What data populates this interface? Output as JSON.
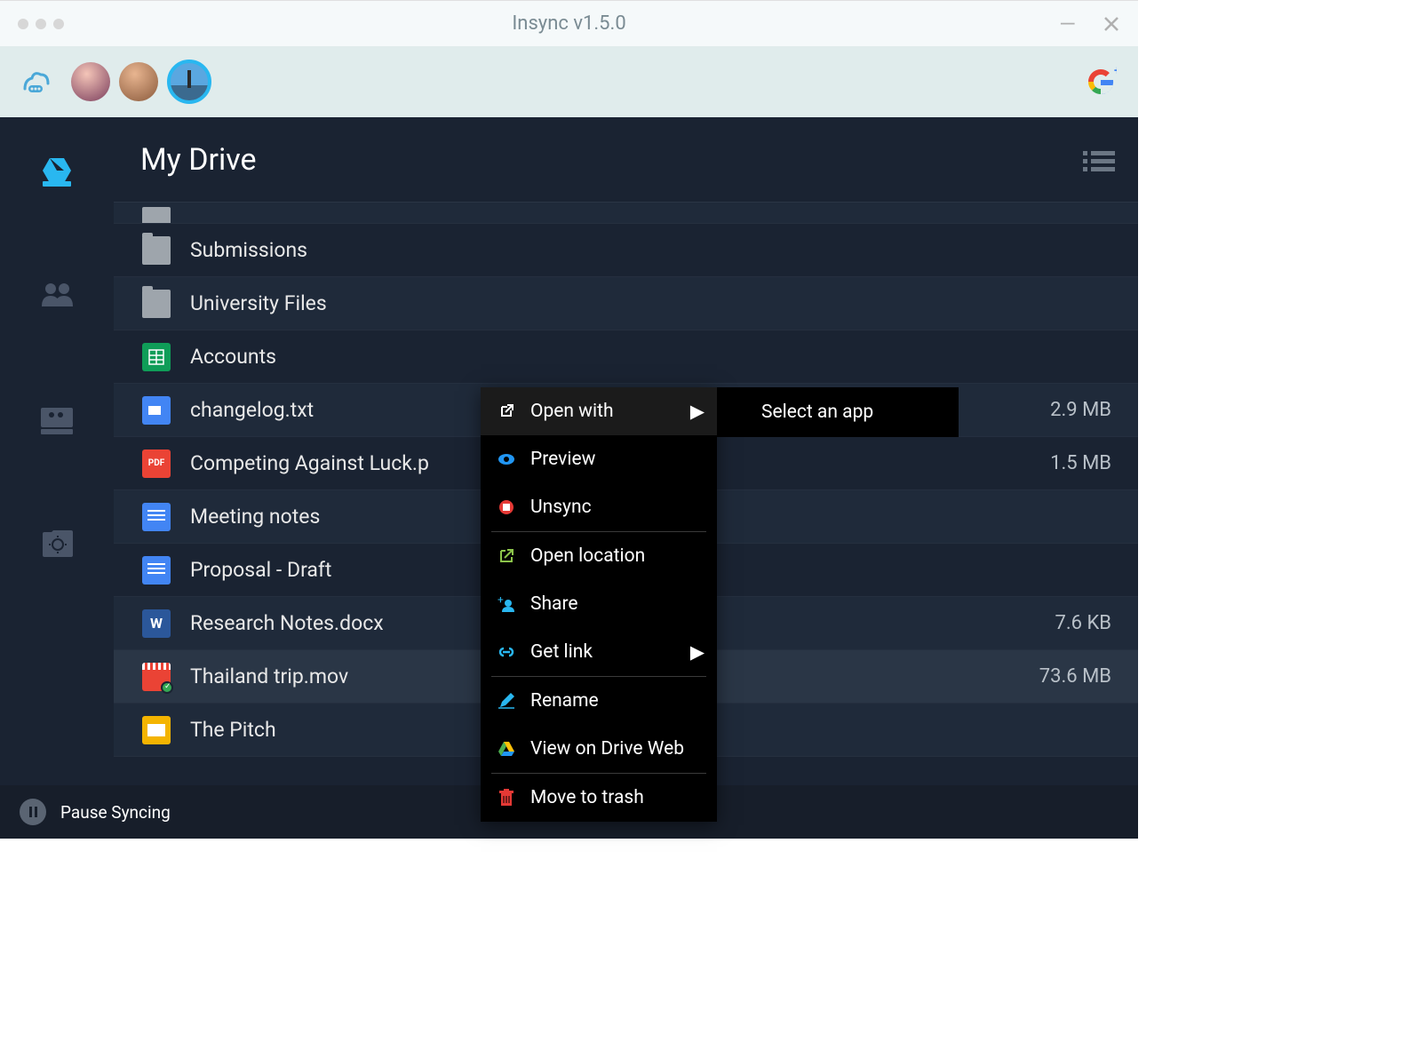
{
  "window": {
    "title": "Insync v1.5.0"
  },
  "header": {
    "title": "My Drive"
  },
  "files": [
    {
      "name": "Submissions",
      "type": "folder",
      "size": ""
    },
    {
      "name": "University Files",
      "type": "folder",
      "size": ""
    },
    {
      "name": "Accounts",
      "type": "sheets",
      "size": ""
    },
    {
      "name": "changelog.txt",
      "type": "doc-page",
      "size": "2.9 MB"
    },
    {
      "name": "Competing Against Luck.p",
      "type": "pdf",
      "size": "1.5 MB"
    },
    {
      "name": "Meeting notes",
      "type": "docs",
      "size": ""
    },
    {
      "name": "Proposal - Draft",
      "type": "docs",
      "size": ""
    },
    {
      "name": "Research Notes.docx",
      "type": "word",
      "size": "7.6 KB"
    },
    {
      "name": "Thailand trip.mov",
      "type": "video",
      "size": "73.6 MB"
    },
    {
      "name": "The Pitch",
      "type": "slides",
      "size": ""
    }
  ],
  "contextMenu": {
    "items": [
      {
        "label": "Open with",
        "icon": "open-external",
        "hasSubmenu": true
      },
      {
        "label": "Preview",
        "icon": "eye"
      },
      {
        "label": "Unsync",
        "icon": "stop"
      },
      {
        "label": "Open location",
        "icon": "location"
      },
      {
        "label": "Share",
        "icon": "share"
      },
      {
        "label": "Get link",
        "icon": "link",
        "hasSubmenu": true
      },
      {
        "label": "Rename",
        "icon": "pencil"
      },
      {
        "label": "View on Drive Web",
        "icon": "drive"
      },
      {
        "label": "Move to trash",
        "icon": "trash"
      }
    ],
    "submenuLabel": "Select an app"
  },
  "footer": {
    "pauseLabel": "Pause Syncing"
  }
}
